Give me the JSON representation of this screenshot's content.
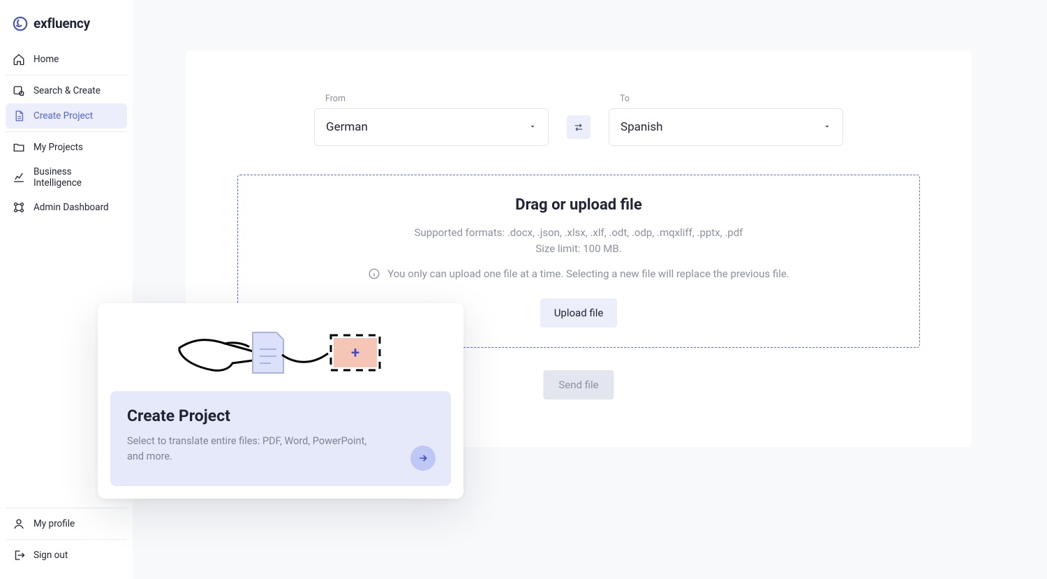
{
  "brand": "exfluency",
  "sidebar": {
    "home": "Home",
    "search_create": "Search & Create",
    "create_project": "Create Project",
    "my_projects": "My Projects",
    "business_intelligence": "Business Intelligence",
    "admin_dashboard": "Admin Dashboard",
    "my_profile": "My profile",
    "sign_out": "Sign out"
  },
  "lang": {
    "from_label": "From",
    "from_value": "German",
    "to_label": "To",
    "to_value": "Spanish"
  },
  "dropzone": {
    "title": "Drag or upload file",
    "formats": "Supported formats: .docx, .json, .xlsx, .xlf, .odt, .odp, .mqxliff, .pptx, .pdf",
    "size_limit": "Size limit: 100 MB.",
    "info": "You only can upload one file at a time. Selecting a new file will replace the previous file.",
    "upload_btn": "Upload file",
    "send_btn": "Send file"
  },
  "card": {
    "title": "Create Project",
    "desc": "Select to translate entire files: PDF, Word, PowerPoint, and more."
  }
}
